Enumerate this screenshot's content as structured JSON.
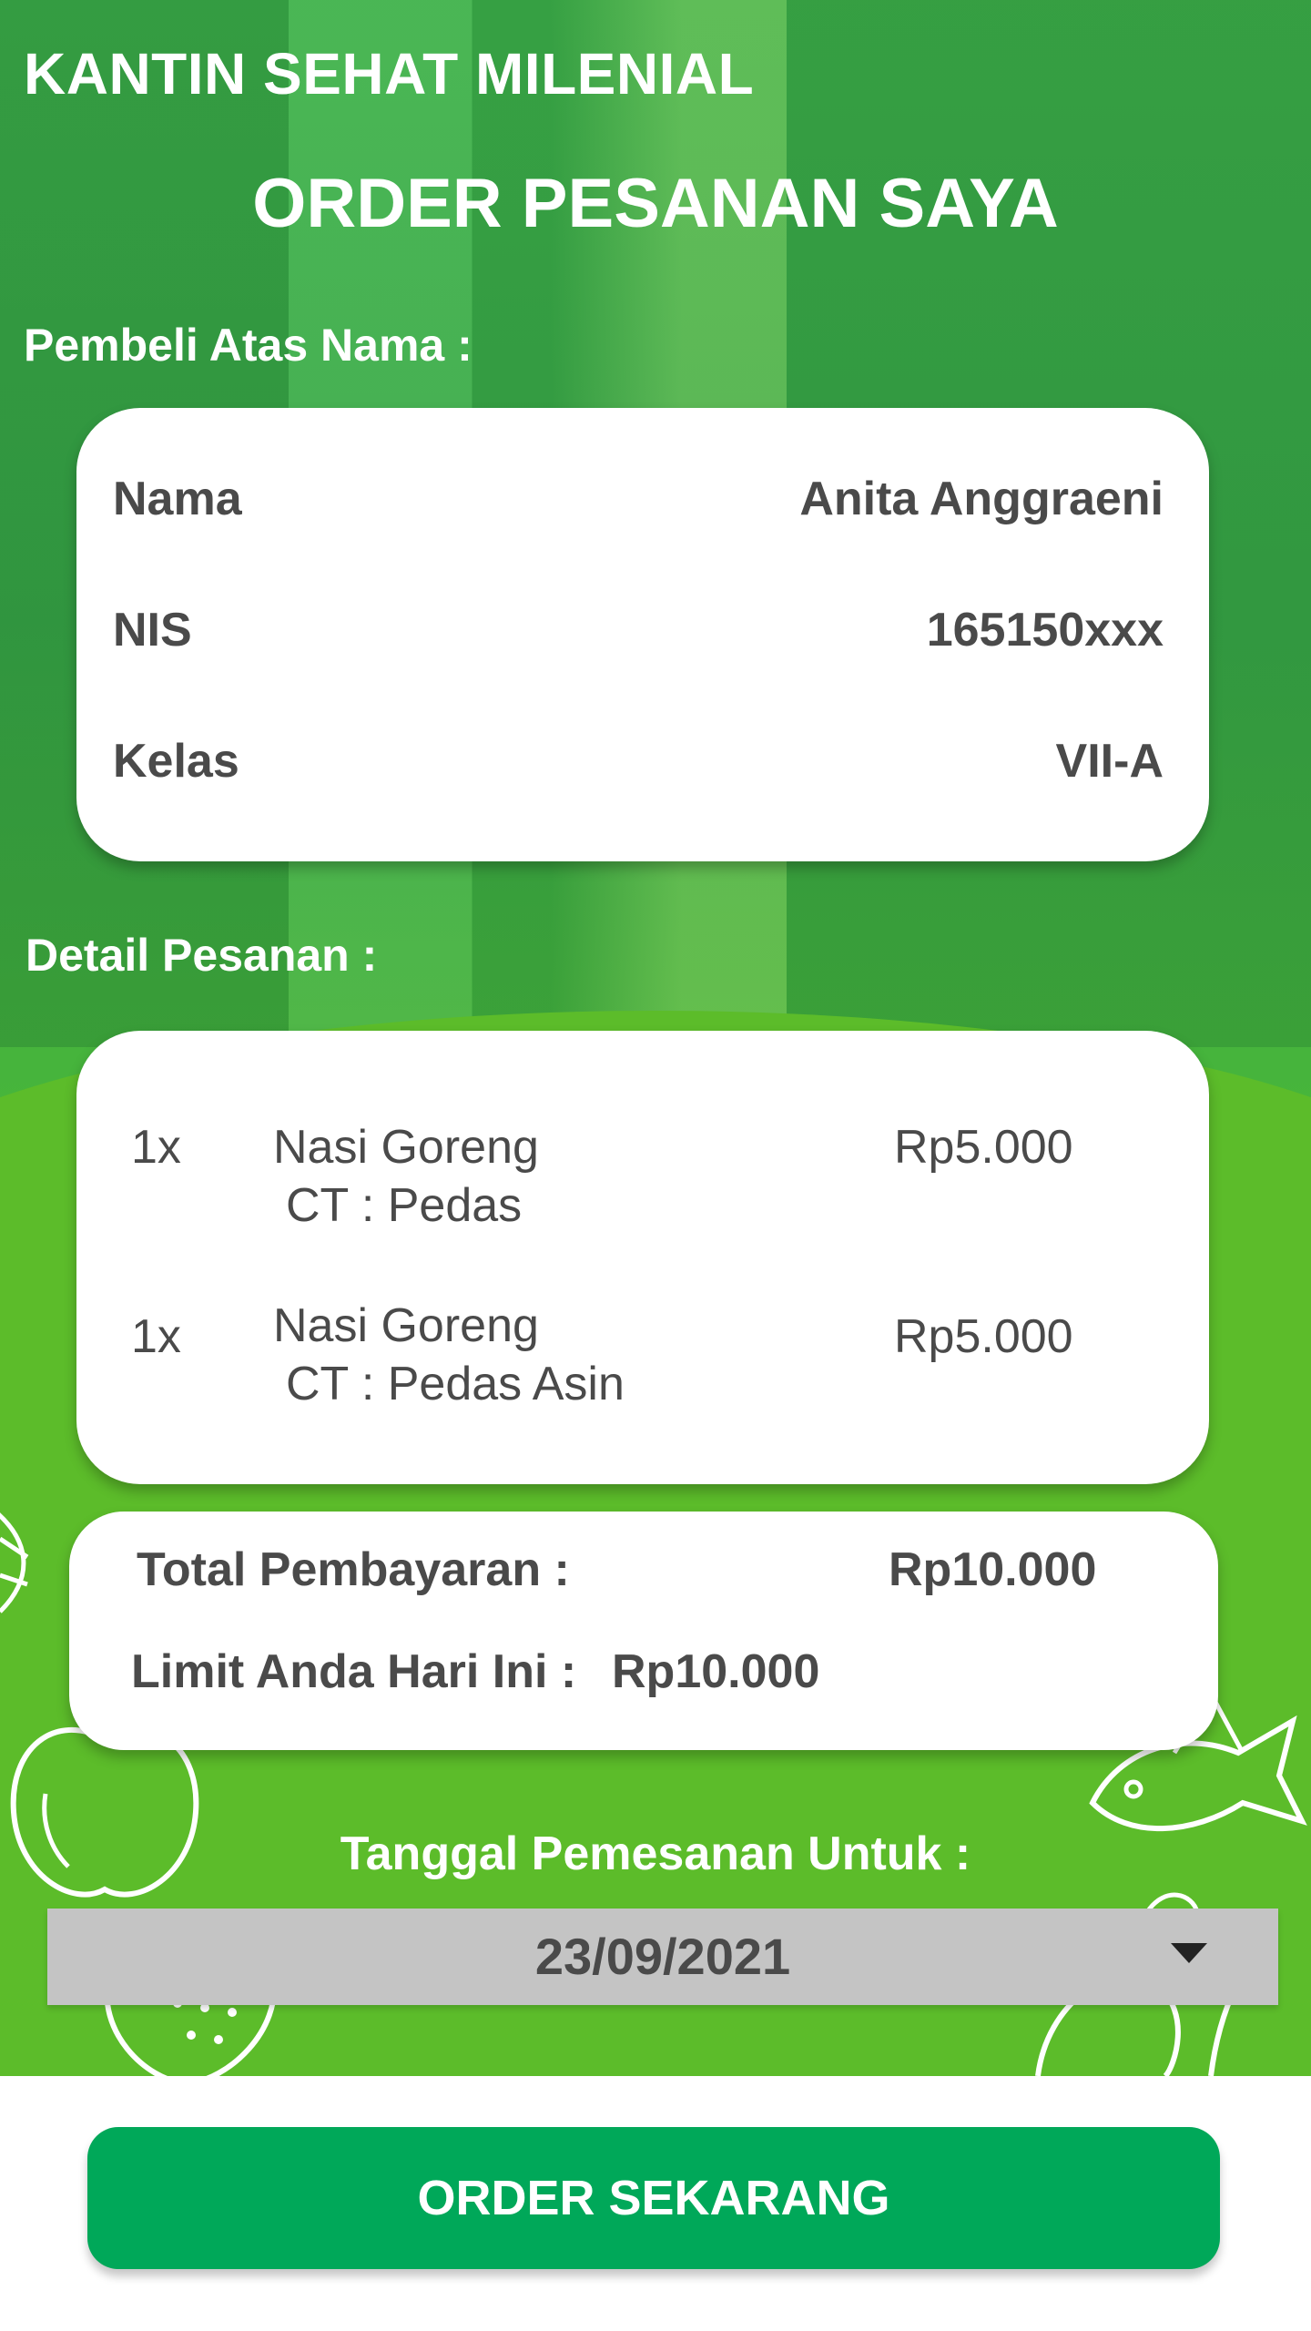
{
  "app": {
    "title": "KANTIN SEHAT MILENIAL"
  },
  "page": {
    "title": "ORDER PESANAN SAYA"
  },
  "buyer": {
    "section_label": "Pembeli Atas Nama :",
    "rows": [
      {
        "label": "Nama",
        "value": "Anita Anggraeni"
      },
      {
        "label": "NIS",
        "value": "165150xxx"
      },
      {
        "label": "Kelas",
        "value": "VII-A"
      }
    ]
  },
  "order": {
    "section_label": "Detail Pesanan :",
    "items": [
      {
        "qty": "1x",
        "name": "Nasi Goreng",
        "note": "CT : Pedas",
        "price": "Rp5.000"
      },
      {
        "qty": "1x",
        "name": "Nasi Goreng",
        "note": "CT : Pedas Asin",
        "price": "Rp5.000"
      }
    ]
  },
  "summary": {
    "total_label": "Total Pembayaran :",
    "total_value": "Rp10.000",
    "limit_label": "Limit Anda Hari Ini :",
    "limit_value": "Rp10.000"
  },
  "date": {
    "label": "Tanggal Pemesanan Untuk :",
    "selected": "23/09/2021"
  },
  "action": {
    "button_label": "ORDER SEKARANG"
  },
  "colors": {
    "primary_green": "#00a859",
    "background_green": "#3fb24a",
    "text_dark": "#4a4a4a",
    "dropdown_gray": "#c4c4c4"
  },
  "icons": [
    "apple-outline-icon",
    "fish-outline-icon",
    "leaf-outline-icon",
    "strawberry-outline-icon",
    "dropdown-caret-icon"
  ]
}
